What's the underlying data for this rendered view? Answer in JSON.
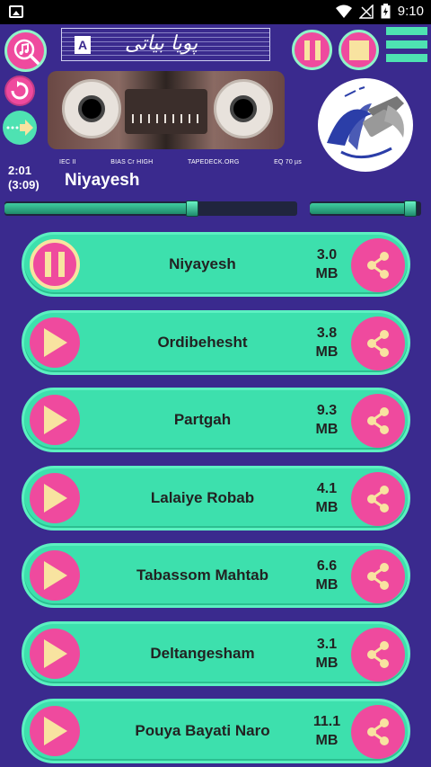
{
  "status_bar": {
    "time": "9:10"
  },
  "cassette": {
    "side": "A",
    "label_script": "پویا بیاتی",
    "info": [
      "IEC II",
      "BIAS Cr HIGH",
      "TAPEDECK.ORG",
      "EQ 70 µs"
    ]
  },
  "player": {
    "current_time": "2:01",
    "total_time": "(3:09)",
    "now_playing": "Niyayesh",
    "seek_progress": 0.64,
    "volume": 0.9
  },
  "colors": {
    "background": "#3a2a8e",
    "accent_pink": "#ef4a9e",
    "accent_green": "#3de0ad",
    "play_icon": "#f8e3a0"
  },
  "tracks": [
    {
      "name": "Niyayesh",
      "size_value": "3.0",
      "size_unit": "MB",
      "state": "playing"
    },
    {
      "name": "Ordibehesht",
      "size_value": "3.8",
      "size_unit": "MB",
      "state": "stopped"
    },
    {
      "name": "Partgah",
      "size_value": "9.3",
      "size_unit": "MB",
      "state": "stopped"
    },
    {
      "name": "Lalaiye Robab",
      "size_value": "4.1",
      "size_unit": "MB",
      "state": "stopped"
    },
    {
      "name": "Tabassom Mahtab",
      "size_value": "6.6",
      "size_unit": "MB",
      "state": "stopped"
    },
    {
      "name": "Deltangesham",
      "size_value": "3.1",
      "size_unit": "MB",
      "state": "stopped"
    },
    {
      "name": "Pouya Bayati Naro",
      "size_value": "11.1",
      "size_unit": "MB",
      "state": "stopped"
    }
  ]
}
